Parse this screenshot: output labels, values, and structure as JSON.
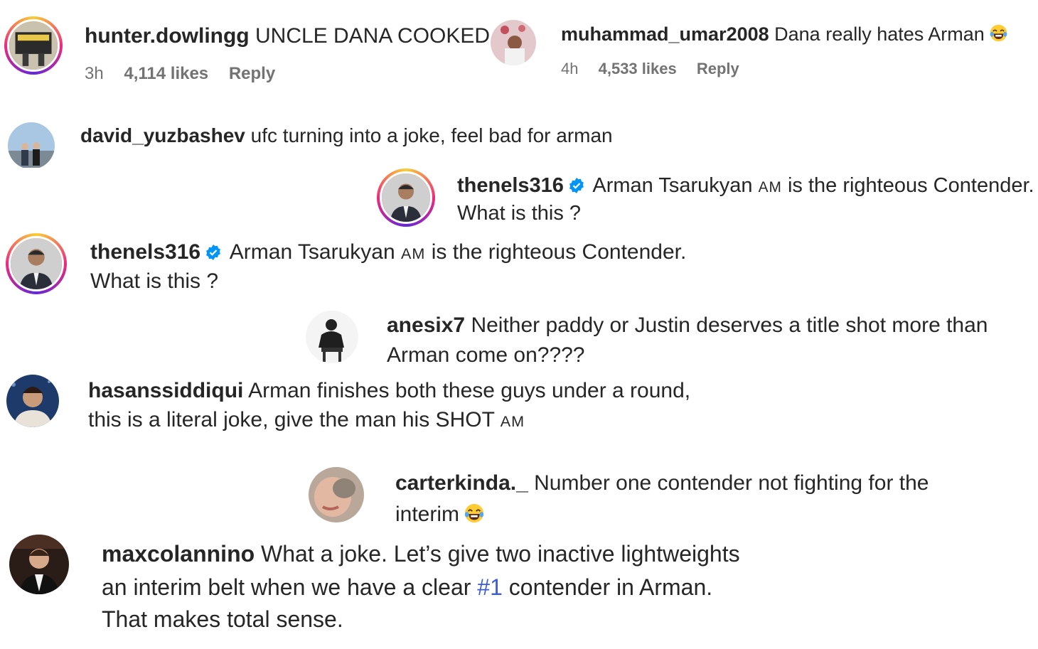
{
  "comments": [
    {
      "user": "hunter.dowlingg",
      "text": "UNCLE DANA COOKED",
      "time": "3h",
      "likes": "4,114 likes",
      "reply": "Reply"
    },
    {
      "user": "muhammad_umar2008",
      "text": "Dana really hates Arman",
      "emoji": "laughing-emoji",
      "time": "4h",
      "likes": "4,533 likes",
      "reply": "Reply"
    },
    {
      "user": "david_yuzbashev",
      "text": "ufc turning into a joke, feel bad for arman"
    },
    {
      "user": "thenels316",
      "verified": true,
      "text_a": "Arman Tsarukyan",
      "tag": "AM",
      "text_b": "is the righteous Contender.",
      "line2": "What is this ?"
    },
    {
      "user": "thenels316",
      "verified": true,
      "text_a": "Arman Tsarukyan",
      "tag": "AM",
      "text_b": "is the righteous Contender.",
      "line2": "What is this ?"
    },
    {
      "user": "anesix7",
      "text": "Neither paddy or Justin deserves a title shot more than",
      "line2": "Arman come on????"
    },
    {
      "user": "hasanssiddiqui",
      "text": "Arman finishes both these guys under a round,",
      "line2_a": "this is a literal joke, give the man his SHOT",
      "tag": "AM"
    },
    {
      "user": "carterkinda._",
      "text": "Number one contender not fighting for the",
      "line2": "interim",
      "emoji": "laughing-emoji"
    },
    {
      "user": "maxcolannino",
      "text": "What a joke. Let’s give two inactive lightweights",
      "line2_a": "an interim belt when we have a clear",
      "hashtag": "#1",
      "line2_b": "contender in Arman.",
      "line3": "That makes total sense."
    }
  ],
  "colors": {
    "username": "#262626",
    "meta": "#737373",
    "hashtag": "#3b5bdb",
    "verified": "#0095f6"
  }
}
